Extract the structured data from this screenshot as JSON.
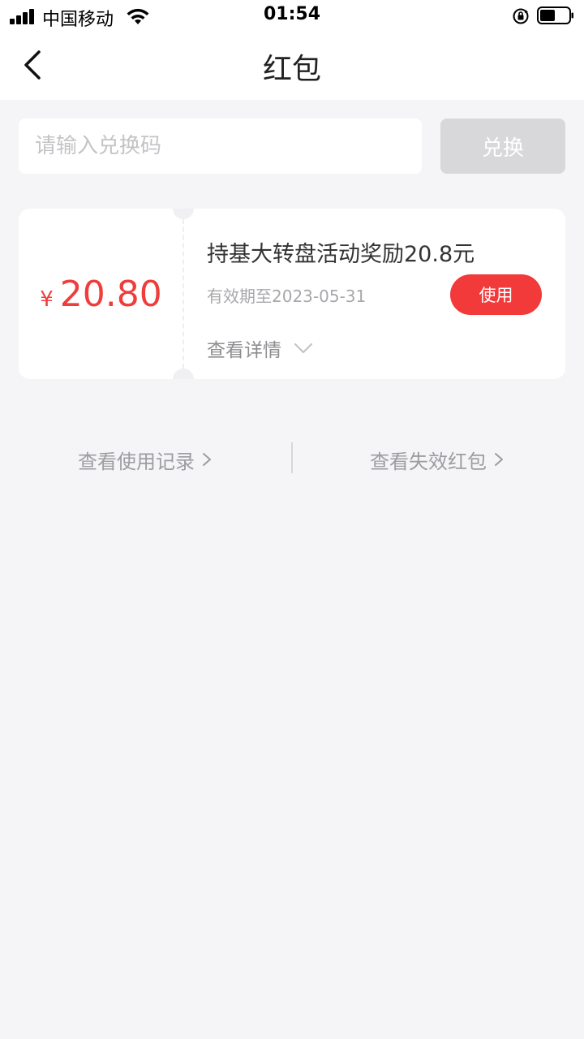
{
  "status_bar": {
    "carrier": "中国移动",
    "time": "01:54"
  },
  "nav": {
    "title": "红包"
  },
  "redeem": {
    "placeholder": "请输入兑换码",
    "button_label": "兑换"
  },
  "coupon": {
    "currency_symbol": "¥",
    "amount": "20.80",
    "title": "持基大转盘活动奖励20.8元",
    "expiry": "有效期至2023-05-31",
    "use_label": "使用",
    "details_label": "查看详情"
  },
  "footer": {
    "usage_record_label": "查看使用记录",
    "expired_label": "查看失效红包"
  },
  "colors": {
    "accent_red": "#ef3d3b",
    "use_button": "#f23a3a",
    "disabled_button": "#d8d8db",
    "page_background": "#f5f5f7"
  }
}
